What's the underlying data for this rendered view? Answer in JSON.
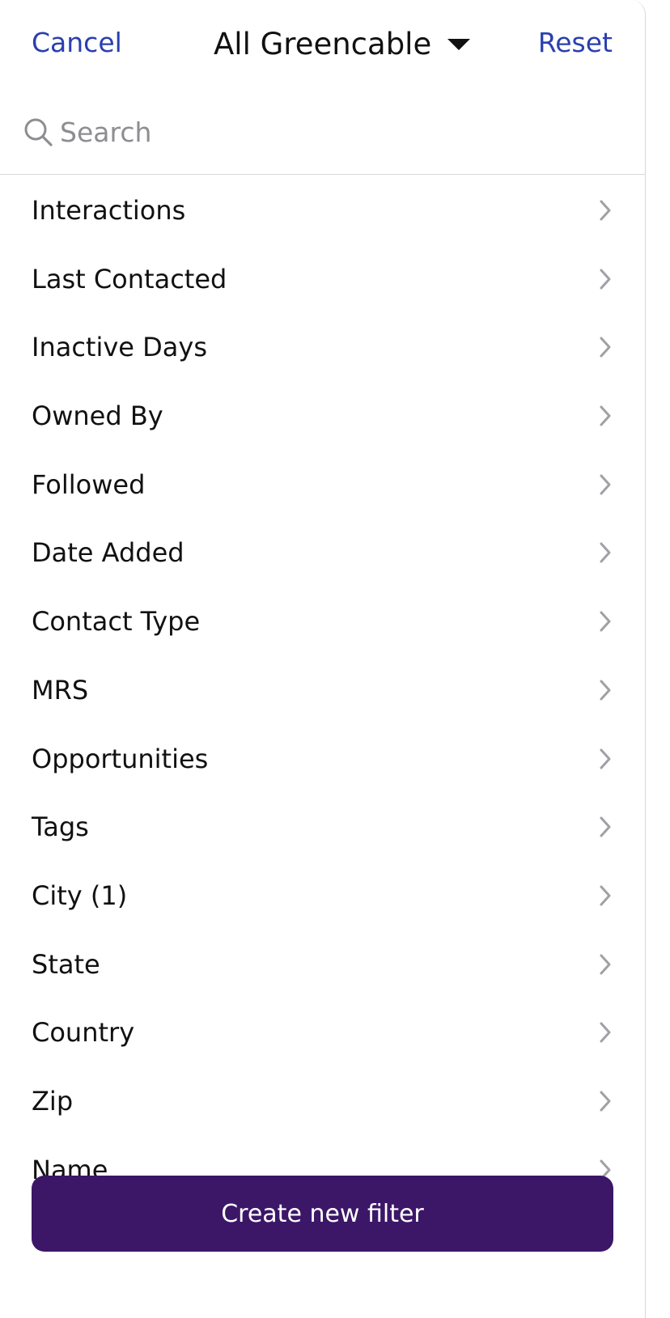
{
  "header": {
    "cancel_label": "Cancel",
    "title": "All Greencable",
    "reset_label": "Reset"
  },
  "search": {
    "placeholder": "Search",
    "value": ""
  },
  "filters": [
    {
      "label": "Interactions"
    },
    {
      "label": "Last Contacted"
    },
    {
      "label": "Inactive Days"
    },
    {
      "label": "Owned By"
    },
    {
      "label": "Followed"
    },
    {
      "label": "Date Added"
    },
    {
      "label": "Contact Type"
    },
    {
      "label": "MRS"
    },
    {
      "label": "Opportunities"
    },
    {
      "label": "Tags"
    },
    {
      "label": "City (1)"
    },
    {
      "label": "State"
    },
    {
      "label": "Country"
    },
    {
      "label": "Zip"
    },
    {
      "label": "Name"
    }
  ],
  "footer": {
    "create_label": "Create new filter"
  },
  "colors": {
    "accent_link": "#2a3fae",
    "primary_button": "#3c1768",
    "text": "#111111",
    "muted": "#8d8d92",
    "divider": "#d9d9dc"
  },
  "icons": {
    "search": "search-icon",
    "dropdown": "caret-down-icon",
    "row": "chevron-right-icon"
  }
}
